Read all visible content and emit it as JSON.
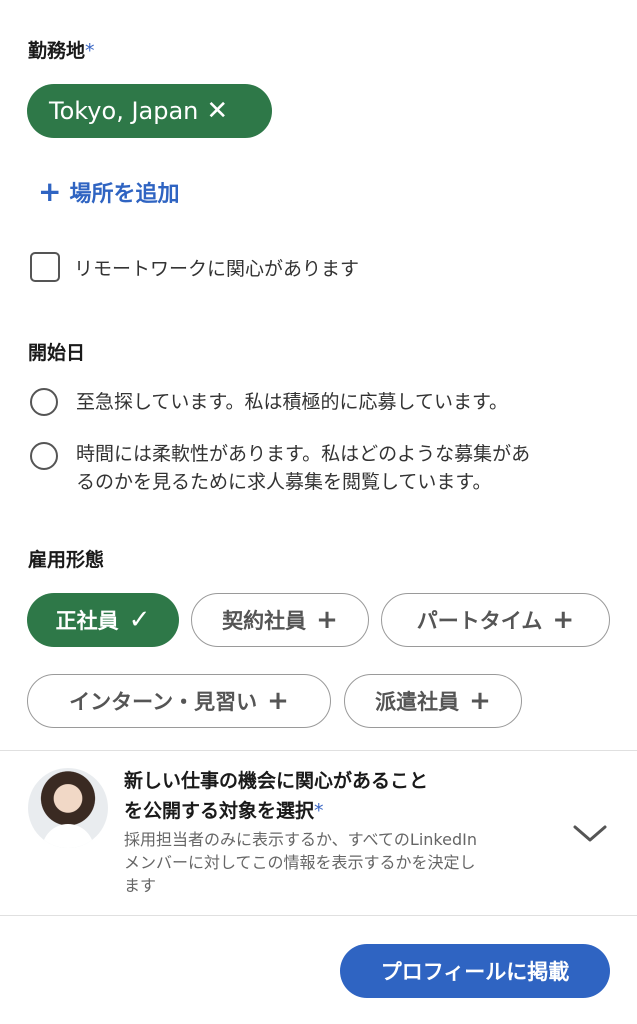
{
  "location": {
    "label": "勤務地",
    "required_mark": "*",
    "chip_text": "Tokyo, Japan",
    "chip_remove_icon": "close-icon",
    "add_label": "場所を追加",
    "remote_label": "リモートワークに関心があります",
    "remote_checked": false
  },
  "start_date": {
    "label": "開始日",
    "options": [
      {
        "line1": "至急探しています。私は積極的に応募しています。",
        "line2": "",
        "selected": false
      },
      {
        "line1": "時間には柔軟性があります。私はどのような募集があ",
        "line2": "るのかを見るために求人募集を閲覧しています。",
        "selected": false
      }
    ]
  },
  "employment_type": {
    "label": "雇用形態",
    "chips": [
      {
        "label": "正社員",
        "selected": true
      },
      {
        "label": "契約社員",
        "selected": false
      },
      {
        "label": "パートタイム",
        "selected": false
      },
      {
        "label": "インターン・見習い",
        "selected": false
      },
      {
        "label": "派遣社員",
        "selected": false
      }
    ]
  },
  "visibility": {
    "title_line1": "新しい仕事の機会に関心があること",
    "title_line2": "を公開する対象を選択",
    "required_mark": "*",
    "desc_line1": "採用担当者のみに表示するか、すべてのLinkedIn",
    "desc_line2": "メンバーに対してこの情報を表示するかを決定し",
    "desc_line3": "ます"
  },
  "actions": {
    "post_label": "プロフィールに掲載"
  },
  "colors": {
    "green": "#2e7848",
    "blue": "#2f64c2"
  }
}
